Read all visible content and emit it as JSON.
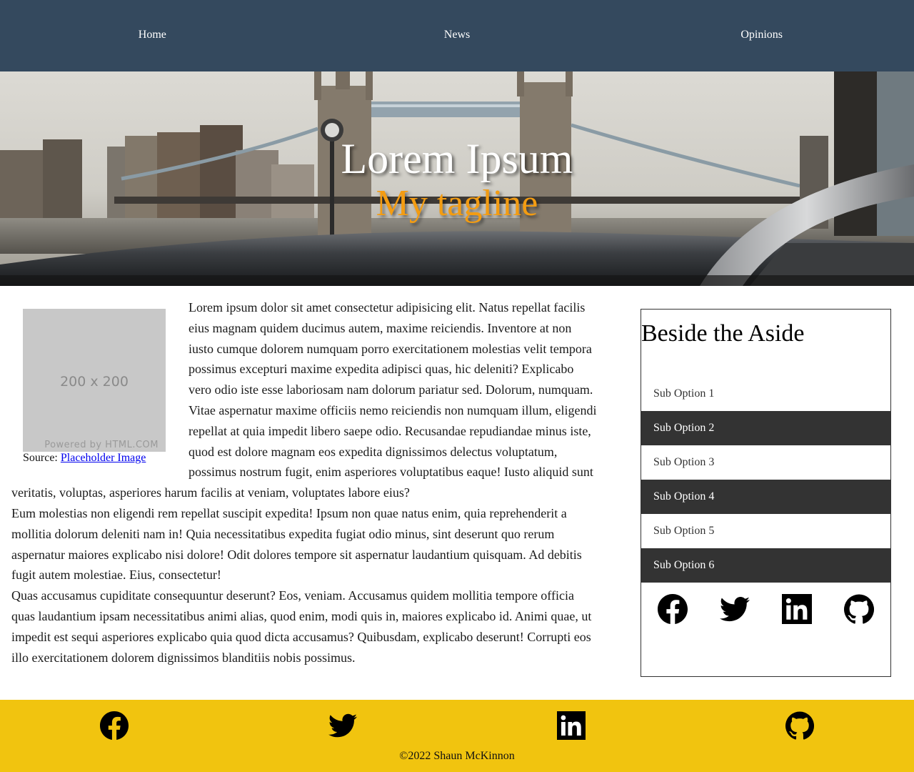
{
  "nav": {
    "items": [
      {
        "label": "Home"
      },
      {
        "label": "News"
      },
      {
        "label": "Opinions"
      }
    ]
  },
  "hero": {
    "title": "Lorem Ipsum",
    "tagline": "My tagline"
  },
  "figure": {
    "placeholder_size": "200 x 200",
    "placeholder_powered": "Powered by HTML.COM",
    "caption_prefix": "Source: ",
    "caption_link": "Placeholder Image"
  },
  "article": {
    "paragraphs": [
      "Lorem ipsum dolor sit amet consectetur adipisicing elit. Natus repellat facilis eius magnam quidem ducimus autem, maxime reiciendis. Inventore at non iusto cumque dolorem numquam porro exercitationem molestias velit tempora possimus excepturi maxime expedita adipisci quas, hic deleniti? Explicabo vero odio iste esse laboriosam nam dolorum pariatur sed. Dolorum, numquam.",
      "Vitae aspernatur maxime officiis nemo reiciendis non numquam illum, eligendi repellat at quia impedit libero saepe odio. Recusandae repudiandae minus iste, quod est dolore magnam eos expedita dignissimos delectus voluptatum, possimus nostrum fugit, enim asperiores voluptatibus eaque! Iusto aliquid sunt veritatis, voluptas, asperiores harum facilis at veniam, voluptates labore eius?",
      "Eum molestias non eligendi rem repellat suscipit expedita! Ipsum non quae natus enim, quia reprehenderit a mollitia dolorum deleniti nam in! Quia necessitatibus expedita fugiat odio minus, sint deserunt quo rerum aspernatur maiores explicabo nisi dolore! Odit dolores tempore sit aspernatur laudantium quisquam. Ad debitis fugit autem molestiae. Eius, consectetur!",
      "Quas accusamus cupiditate consequuntur deserunt? Eos, veniam. Accusamus quidem mollitia tempore officia quas laudantium ipsam necessitatibus animi alias, quod enim, modi quis in, maiores explicabo id. Animi quae, ut impedit est sequi asperiores explicabo quia quod dicta accusamus? Quibusdam, explicabo deserunt! Corrupti eos illo exercitationem dolorem dignissimos blanditiis nobis possimus."
    ]
  },
  "aside": {
    "title": "Beside the Aside",
    "options": [
      {
        "label": "Sub Option 1"
      },
      {
        "label": "Sub Option 2"
      },
      {
        "label": "Sub Option 3"
      },
      {
        "label": "Sub Option 4"
      },
      {
        "label": "Sub Option 5"
      },
      {
        "label": "Sub Option 6"
      }
    ],
    "social_icons": [
      "facebook-icon",
      "twitter-icon",
      "linkedin-icon",
      "github-icon"
    ]
  },
  "footer": {
    "social_icons": [
      "facebook-icon",
      "twitter-icon",
      "linkedin-icon",
      "github-icon"
    ],
    "copyright": "©2022 Shaun McKinnon"
  },
  "colors": {
    "nav_bg": "#34495e",
    "tagline": "#f39c12",
    "footer_bg": "#f1c40f",
    "aside_dark_item": "#333333"
  }
}
